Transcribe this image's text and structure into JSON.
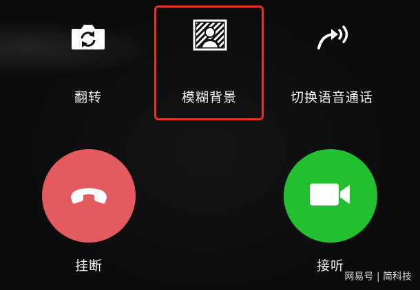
{
  "actions": {
    "flip": {
      "label": "翻转",
      "icon": "camera-flip-icon"
    },
    "blur": {
      "label": "模糊背景",
      "icon": "blur-background-icon"
    },
    "voice": {
      "label": "切换语音通话",
      "icon": "switch-to-voice-icon"
    }
  },
  "call": {
    "hangup": {
      "label": "挂断",
      "icon": "hang-up-phone-icon",
      "color": "#e35a5f"
    },
    "answer": {
      "label": "接听",
      "icon": "video-camera-icon",
      "color": "#22c02e"
    }
  },
  "highlight_color": "#e3342a",
  "watermark": "网易号 | 简科技"
}
